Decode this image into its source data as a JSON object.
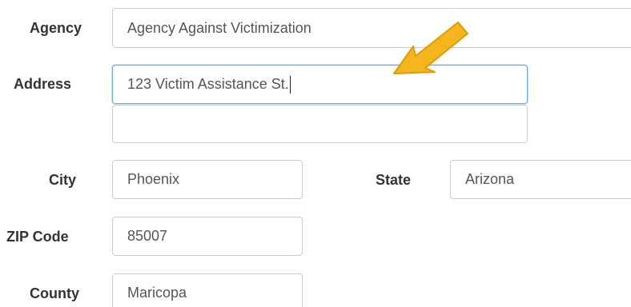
{
  "form": {
    "agency": {
      "label": "Agency",
      "value": "Agency Against Victimization"
    },
    "address": {
      "label": "Address",
      "line1": "123 Victim Assistance St.",
      "line2": ""
    },
    "city": {
      "label": "City",
      "value": "Phoenix"
    },
    "state": {
      "label": "State",
      "value": "Arizona"
    },
    "zip": {
      "label": "ZIP Code",
      "value": "85007"
    },
    "county": {
      "label": "County",
      "value": "Maricopa"
    }
  },
  "annotation": {
    "icon": "arrow-pointer-icon",
    "color": "#f5b51d"
  },
  "colors": {
    "focus_border": "#66afe9",
    "border": "#cccccc",
    "label": "#333333",
    "value": "#555555"
  }
}
